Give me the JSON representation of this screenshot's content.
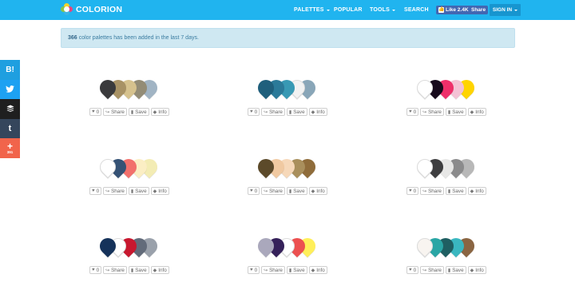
{
  "header": {
    "logo_text": "COLORION",
    "nav": [
      {
        "label": "PALETTES",
        "dropdown": true
      },
      {
        "label": "POPULAR",
        "dropdown": false
      },
      {
        "label": "TOOLS",
        "dropdown": true
      },
      {
        "label": "SEARCH",
        "dropdown": false
      }
    ],
    "fb_like": "Like 2.4K",
    "fb_share": "Share",
    "signin": "SIGN IN",
    "bg_color": "#20b4ef"
  },
  "alert": {
    "count": "366",
    "text": "color palettes has been added in the last 7 days."
  },
  "social": [
    {
      "name": "hatena",
      "label": "B!",
      "color": "#1f9fe0"
    },
    {
      "name": "twitter",
      "label": "🐦",
      "color": "#1da1f2"
    },
    {
      "name": "buffer",
      "label": "≣",
      "color": "#1f1f1f"
    },
    {
      "name": "tumblr",
      "label": "t",
      "color": "#35465c"
    },
    {
      "name": "addthis",
      "label": "+",
      "color": "#f1644b",
      "count": "391"
    }
  ],
  "actions": {
    "likes": "0",
    "share": "Share",
    "save": "Save",
    "info": "Info"
  },
  "palettes": [
    {
      "colors": [
        "#3a3a3c",
        "#a89265",
        "#d6c28e",
        "#938c76",
        "#a1b4c4"
      ]
    },
    {
      "colors": [
        "#1f5f7c",
        "#2b7a99",
        "#3899b4",
        "#f2f2f2",
        "#89a6b8"
      ]
    },
    {
      "colors": [
        "#ffffff",
        "#170a1c",
        "#ee2f6a",
        "#f4c2d5",
        "#ffd400"
      ]
    },
    {
      "colors": [
        "#ffffff",
        "#355275",
        "#f2706c",
        "#fbeec4",
        "#f3ecb4"
      ]
    },
    {
      "colors": [
        "#5c4a2a",
        "#f0c9a1",
        "#f6d8b9",
        "#a98f5c",
        "#8f6c3a"
      ]
    },
    {
      "colors": [
        "#ffffff",
        "#3e3e40",
        "#e7e7e6",
        "#8b8b8c",
        "#b8b8b8"
      ]
    },
    {
      "colors": [
        "#15325a",
        "#ffffff",
        "#c8182f",
        "#626b7a",
        "#9aa1ab"
      ]
    },
    {
      "colors": [
        "#aaa8bc",
        "#35215a",
        "#ffffff",
        "#ec5050",
        "#ffef5a"
      ]
    },
    {
      "colors": [
        "#f8f4f0",
        "#2aa6a5",
        "#1f5f62",
        "#3ab7c0",
        "#8a6542"
      ]
    }
  ]
}
